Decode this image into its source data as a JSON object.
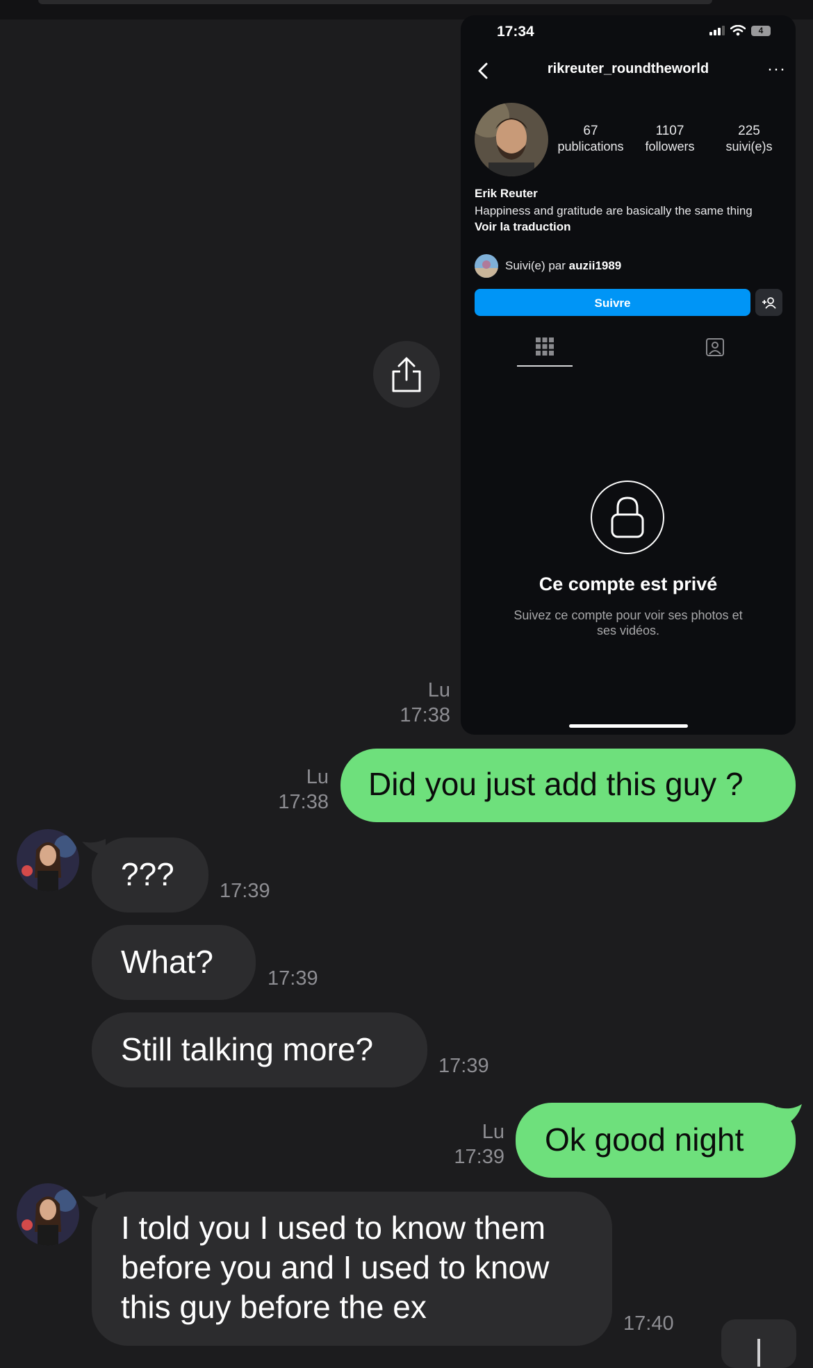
{
  "shared_screenshot": {
    "status_time": "17:34",
    "battery": "4",
    "username": "rikreuter_roundtheworld",
    "more_label": "···",
    "stats": [
      {
        "value": "67",
        "label": "publications"
      },
      {
        "value": "1107",
        "label": "followers"
      },
      {
        "value": "225",
        "label": "suivi(e)s"
      }
    ],
    "full_name": "Erik Reuter",
    "bio": "Happiness and gratitude are basically the same thing",
    "translate_label": "Voir la traduction",
    "followed_by_prefix": "Suivi(e) par",
    "followed_by_user": "auzii1989",
    "follow_button": "Suivre",
    "private_title": "Ce compte est privé",
    "private_desc": "Suivez ce compte pour voir ses photos et ses vidéos.",
    "timestamp_day": "Lu",
    "timestamp_time": "17:38"
  },
  "messages": [
    {
      "direction": "out",
      "text": "Did you just add this guy ?",
      "day": "Lu",
      "time": "17:38"
    },
    {
      "direction": "in",
      "text": "???",
      "time": "17:39"
    },
    {
      "direction": "in",
      "text": "What?",
      "time": "17:39"
    },
    {
      "direction": "in",
      "text": "Still talking more?",
      "time": "17:39"
    },
    {
      "direction": "out",
      "text": "Ok good night",
      "day": "Lu",
      "time": "17:39"
    },
    {
      "direction": "in",
      "text": "I told you I used to know them before you and I used to know this guy before the ex",
      "time": "17:40"
    }
  ],
  "icons": {
    "share": "share-icon",
    "back": "chevron-left-icon",
    "lock": "lock-icon",
    "grid": "grid-icon",
    "tagged": "tagged-icon",
    "add_user": "add-user-icon",
    "scroll": "arrow-down-icon"
  },
  "colors": {
    "outgoing_bubble": "#6ee07c",
    "incoming_bubble": "#2c2c2e",
    "background": "#1c1c1e",
    "follow_button": "#0095f6"
  }
}
